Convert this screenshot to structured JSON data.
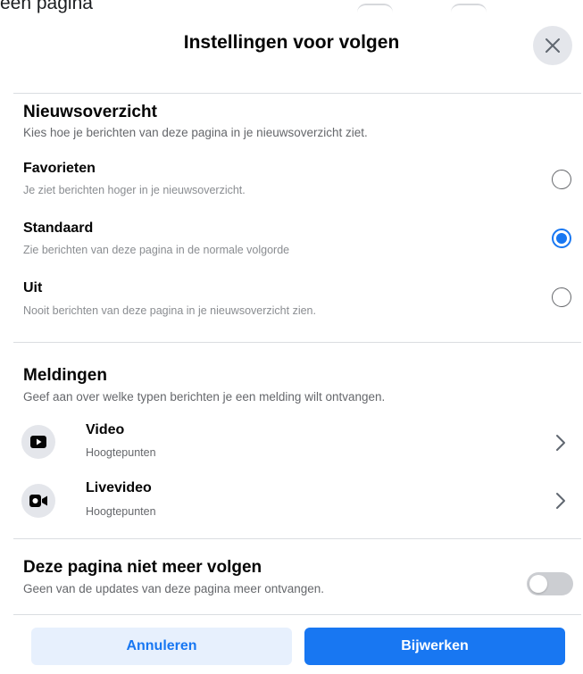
{
  "top_cut_text": "een pagina",
  "dialog": {
    "title": "Instellingen voor volgen",
    "close_icon": "close-icon"
  },
  "news_feed": {
    "title": "Nieuwsoverzicht",
    "subtitle": "Kies hoe je berichten van deze pagina in je nieuwsoverzicht ziet.",
    "options": [
      {
        "label": "Favorieten",
        "description": "Je ziet berichten hoger in je nieuwsoverzicht.",
        "selected": false
      },
      {
        "label": "Standaard",
        "description": "Zie berichten van deze pagina in de normale volgorde",
        "selected": true
      },
      {
        "label": "Uit",
        "description": "Nooit berichten van deze pagina in je nieuwsoverzicht zien.",
        "selected": false
      }
    ]
  },
  "notifications": {
    "title": "Meldingen",
    "subtitle": "Geef aan over welke typen berichten je een melding wilt ontvangen.",
    "items": [
      {
        "label": "Video",
        "sublabel": "Hoogtepunten",
        "icon": "video-play-icon"
      },
      {
        "label": "Livevideo",
        "sublabel": "Hoogtepunten",
        "icon": "live-video-camera-icon"
      }
    ]
  },
  "unfollow": {
    "title": "Deze pagina niet meer volgen",
    "subtitle": "Geen van de updates van deze pagina meer ontvangen.",
    "toggle_on": false
  },
  "footer": {
    "cancel_label": "Annuleren",
    "update_label": "Bijwerken"
  },
  "colors": {
    "accent": "#1877f2",
    "cancel_bg": "#e7f0fd",
    "divider": "#dadde1",
    "icon_bg": "#e4e6eb"
  }
}
